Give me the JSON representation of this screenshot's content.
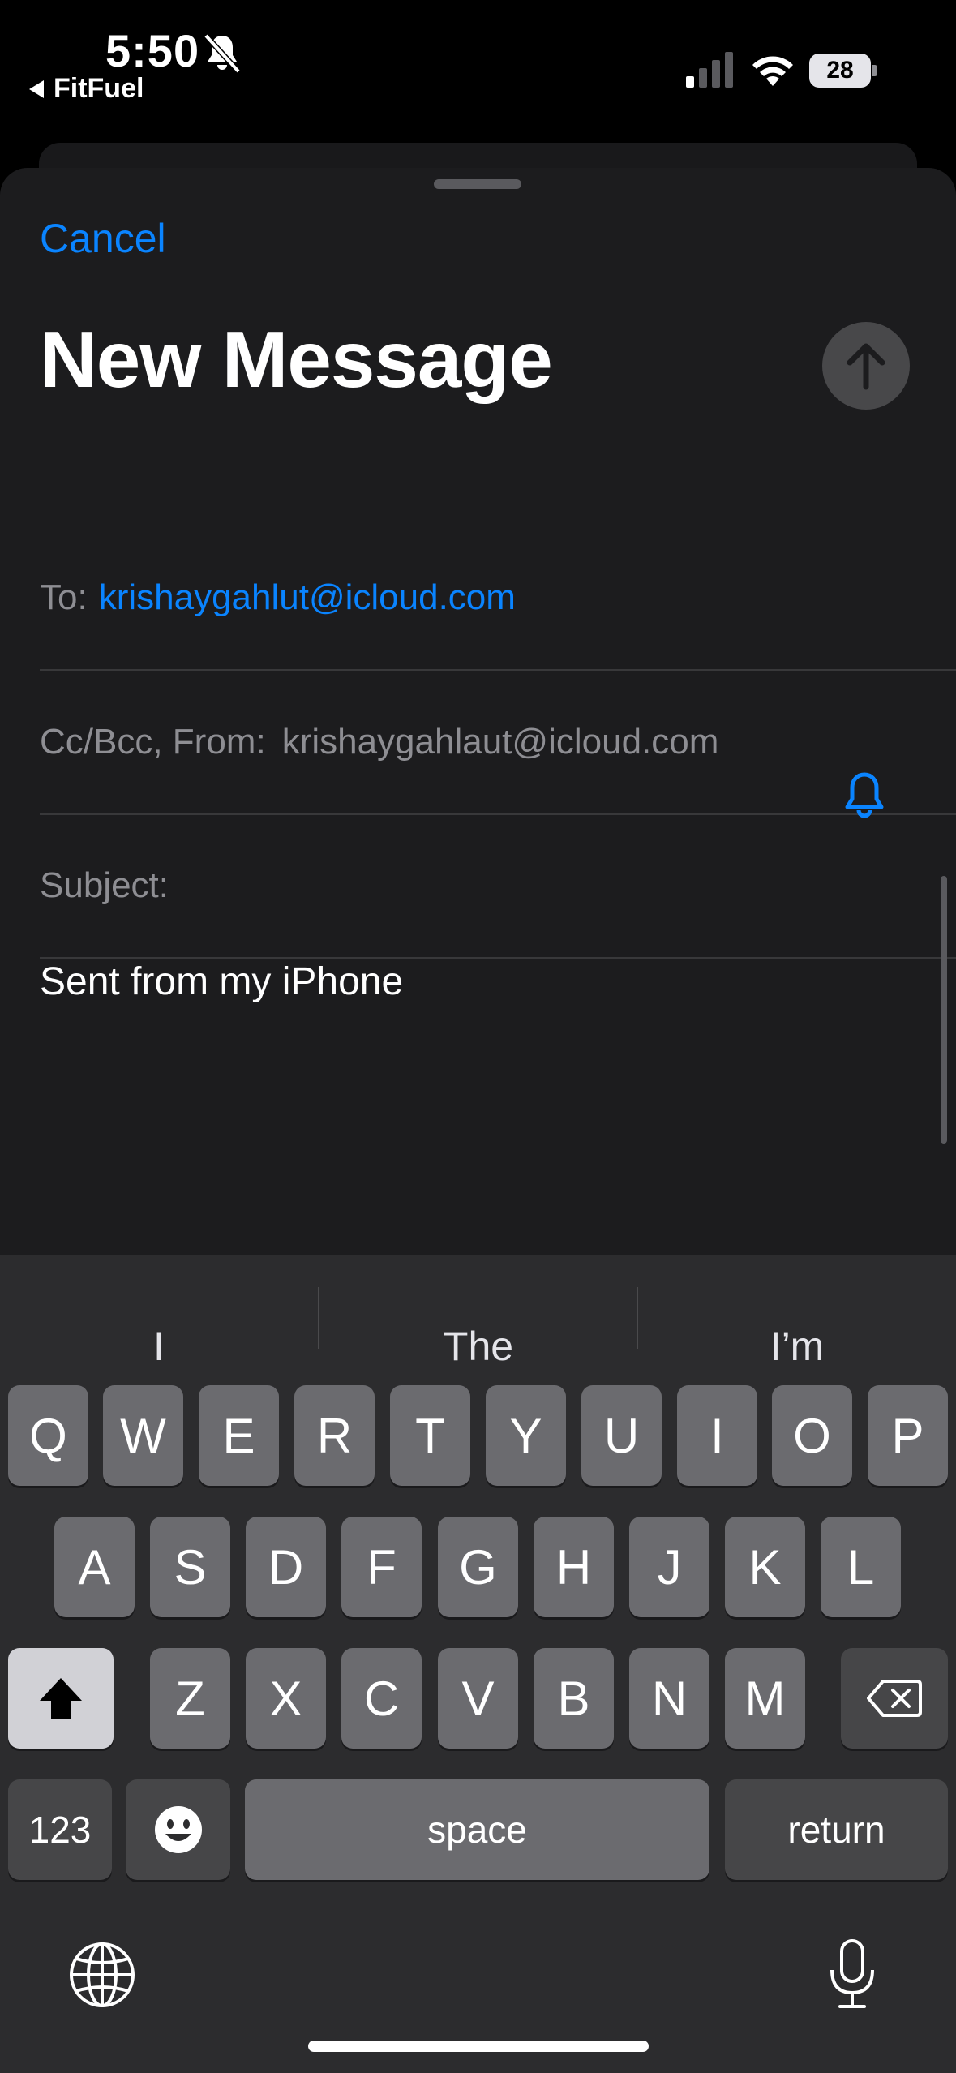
{
  "status_bar": {
    "time": "5:50",
    "back_app": "FitFuel",
    "battery": "28"
  },
  "compose": {
    "cancel_label": "Cancel",
    "title": "New Message",
    "to_label": "To:",
    "to_value": "krishaygahlut@icloud.com",
    "ccbcc_label": "Cc/Bcc, From:",
    "from_value": "krishaygahlaut@icloud.com",
    "subject_label": "Subject:",
    "body": "Sent from my iPhone"
  },
  "keyboard": {
    "suggestions": [
      "I",
      "The",
      "I’m"
    ],
    "row1": [
      "Q",
      "W",
      "E",
      "R",
      "T",
      "Y",
      "U",
      "I",
      "O",
      "P"
    ],
    "row2": [
      "A",
      "S",
      "D",
      "F",
      "G",
      "H",
      "J",
      "K",
      "L"
    ],
    "row3": [
      "Z",
      "X",
      "C",
      "V",
      "B",
      "N",
      "M"
    ],
    "numbers_label": "123",
    "space_label": "space",
    "return_label": "return"
  },
  "colors": {
    "accent": "#0a84ff",
    "sheet": "#1c1c1e",
    "keyboard": "#2c2c2e"
  }
}
